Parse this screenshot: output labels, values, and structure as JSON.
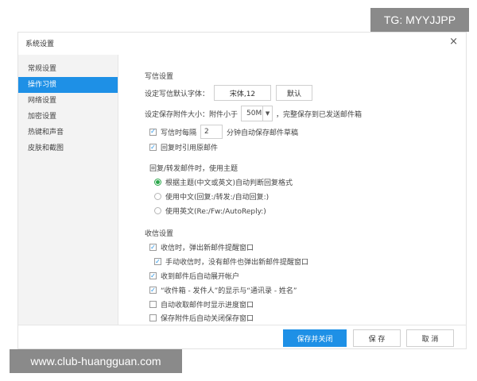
{
  "watermarks": {
    "top": "TG: MYYJJPP",
    "bottom": "www.club-huangguan.com"
  },
  "dialog": {
    "title": "系统设置",
    "close": "×"
  },
  "sidebar": {
    "items": [
      {
        "label": "常规设置",
        "active": false
      },
      {
        "label": "操作习惯",
        "active": true
      },
      {
        "label": "网络设置",
        "active": false
      },
      {
        "label": "加密设置",
        "active": false
      },
      {
        "label": "热键和声音",
        "active": false
      },
      {
        "label": "皮肤和截图",
        "active": false
      }
    ]
  },
  "compose": {
    "section_title": "写信设置",
    "font": {
      "label": "设定写信默认字体：",
      "value": "宋体,12",
      "default_button": "默认"
    },
    "attachment": {
      "label": "设定保存附件大小：附件小于",
      "value": "50M",
      "suffix": "，完整保存到已发送邮件箱"
    },
    "autosave": {
      "prefix": "写信时每隔",
      "value": "2",
      "suffix": "分钟自动保存邮件草稿",
      "checked": true
    },
    "quote_original": {
      "label": "回复时引用原邮件",
      "checked": true
    },
    "reply_subject": {
      "label": "回复/转发邮件时，使用主题",
      "options": [
        {
          "label": "根据主题(中文或英文)自动判断回复格式",
          "selected": true
        },
        {
          "label": "使用中文(回复:/转发:/自动回复:)",
          "selected": false
        },
        {
          "label": "使用英文(Re:/Fw:/AutoReply:)",
          "selected": false
        }
      ]
    }
  },
  "receive": {
    "section_title": "收信设置",
    "items": [
      {
        "label": "收信时，弹出新邮件提醒窗口",
        "checked": true
      },
      {
        "label": "手动收信时，没有邮件也弹出新邮件提醒窗口",
        "checked": true
      },
      {
        "label": "收到邮件后自动展开帐户",
        "checked": true
      },
      {
        "label": "“收件箱 - 发件人”的显示与“通讯录 - 姓名”",
        "checked": true
      },
      {
        "label": "自动收取邮件时显示进度窗口",
        "checked": false
      },
      {
        "label": "保存附件后自动关闭保存窗口",
        "checked": false
      }
    ]
  },
  "footer": {
    "save_close": "保存并关闭",
    "save": "保 存",
    "cancel": "取 消"
  },
  "colors": {
    "accent": "#1e90e6",
    "radio_selected": "#2aa74a"
  }
}
